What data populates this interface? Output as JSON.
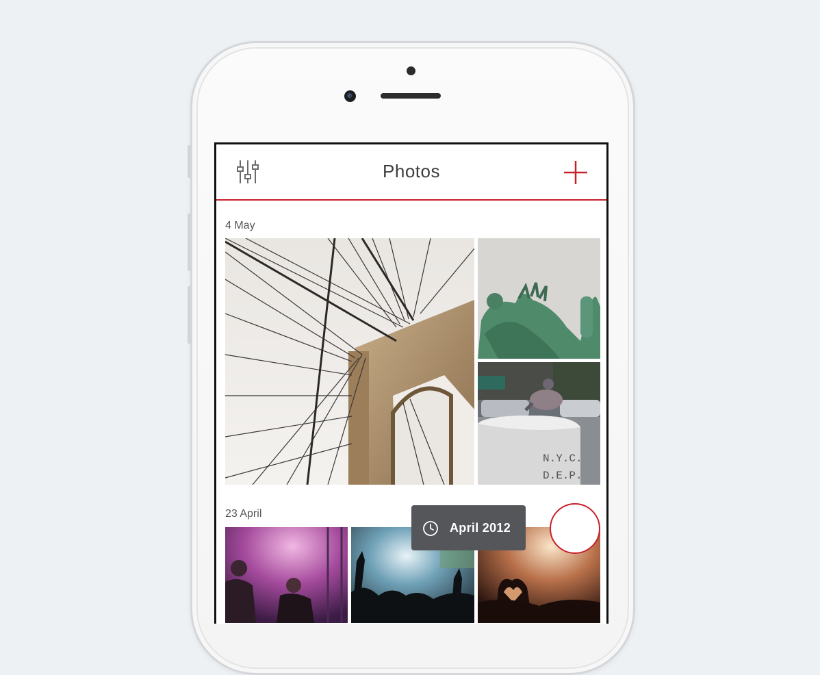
{
  "header": {
    "title": "Photos",
    "filter_icon": "sliders-icon",
    "add_icon": "plus-icon"
  },
  "sections": [
    {
      "date": "4 May",
      "photos": [
        {
          "subject": "brooklyn-bridge"
        },
        {
          "subject": "statue-of-liberty"
        },
        {
          "subject": "pigeon-on-post"
        }
      ]
    },
    {
      "date": "23 April",
      "photos": [
        {
          "subject": "concert-performers"
        },
        {
          "subject": "concert-crowd"
        },
        {
          "subject": "concert-heart-hands"
        }
      ]
    }
  ],
  "photo_texts": {
    "post_stamp_line1": "N.Y.C.",
    "post_stamp_line2": "D.E.P."
  },
  "scrubber": {
    "label": "April 2012",
    "icon": "clock-icon"
  },
  "colors": {
    "accent": "#c8202a",
    "pill_bg": "#54565a",
    "page_bg": "#eef1f4"
  }
}
